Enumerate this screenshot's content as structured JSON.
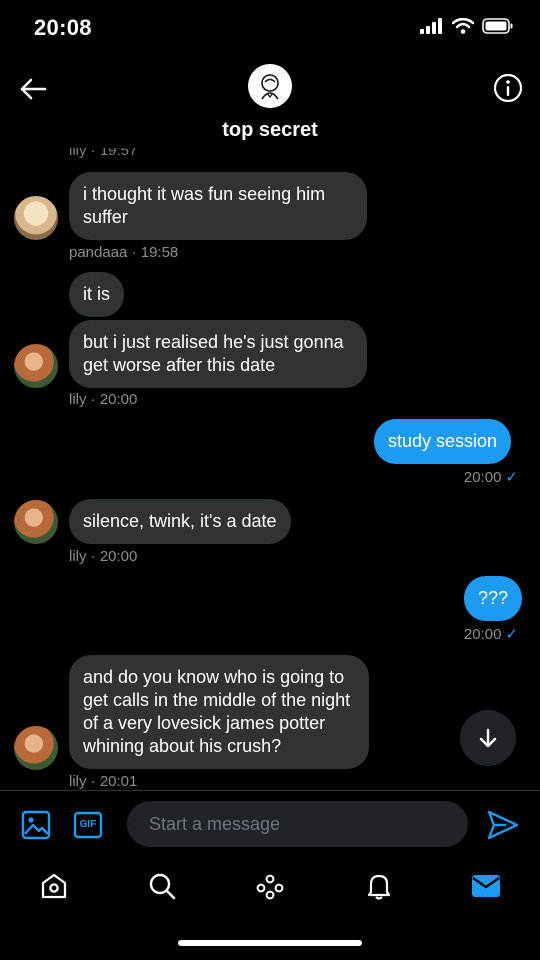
{
  "status_bar": {
    "time": "20:08"
  },
  "header": {
    "title": "top secret"
  },
  "messages": {
    "top_meta": "lily · 19:57",
    "m1": {
      "text": "i thought it was fun seeing him suffer",
      "meta": "pandaaa · 19:58"
    },
    "m2": {
      "text": "it is"
    },
    "m3": {
      "text": "but i just realised he's just gonna get worse after this date",
      "meta": "lily · 20:00"
    },
    "m4": {
      "text": "study session",
      "meta": "20:00"
    },
    "m5": {
      "text": "silence, twink, it's a date",
      "meta": "lily · 20:00"
    },
    "m6": {
      "text": "???",
      "meta": "20:00"
    },
    "m7": {
      "text": "and do you know who is going to get calls in the middle of the night of a very lovesick james potter whining about his crush?",
      "meta": "lily · 20:01"
    }
  },
  "composer": {
    "placeholder": "Start a message",
    "gif_label": "GIF"
  },
  "icons": {
    "back": "arrow-left-icon",
    "info": "info-icon",
    "image": "image-icon",
    "gif": "gif-icon",
    "send": "send-icon",
    "home": "home-icon",
    "search": "search-icon",
    "spaces": "spaces-icon",
    "notifications": "bell-icon",
    "messages": "mail-icon",
    "scroll_down": "arrow-down-icon"
  },
  "colors": {
    "accent": "#1d9bf0",
    "incoming_bubble": "#2f3336",
    "background": "#000000",
    "meta": "#8b8f94"
  }
}
